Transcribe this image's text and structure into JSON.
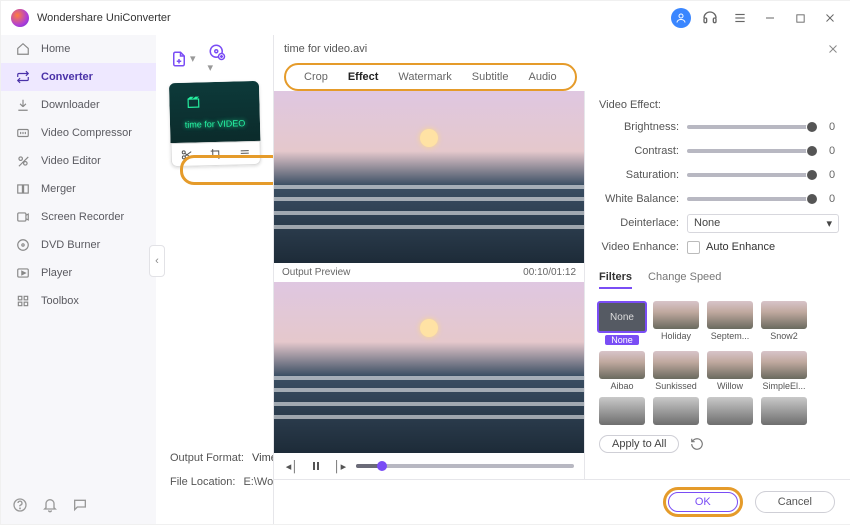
{
  "app": {
    "title": "Wondershare UniConverter"
  },
  "sidebar": {
    "items": [
      {
        "label": "Home"
      },
      {
        "label": "Converter"
      },
      {
        "label": "Downloader"
      },
      {
        "label": "Video Compressor"
      },
      {
        "label": "Video Editor"
      },
      {
        "label": "Merger"
      },
      {
        "label": "Screen Recorder"
      },
      {
        "label": "DVD Burner"
      },
      {
        "label": "Player"
      },
      {
        "label": "Toolbox"
      }
    ]
  },
  "stage": {
    "outputFormatLabel": "Output Format:",
    "outputFormatValue": "Vimeo",
    "fileLocLabel": "File Location:",
    "fileLocValue": "E:\\Won",
    "clipText": "time for\nVIDEO"
  },
  "editor": {
    "filename": "time for video.avi",
    "tabs": [
      "Crop",
      "Effect",
      "Watermark",
      "Subtitle",
      "Audio"
    ],
    "activeTab": "Effect",
    "previewLabel": "Output Preview",
    "time": "00:10/01:12",
    "ctrlTitle": "Video Effect:",
    "controls": {
      "brightness": {
        "label": "Brightness:",
        "value": 0
      },
      "contrast": {
        "label": "Contrast:",
        "value": 0
      },
      "saturation": {
        "label": "Saturation:",
        "value": 0
      },
      "whitebal": {
        "label": "White Balance:",
        "value": 0
      },
      "deinterlace": {
        "label": "Deinterlace:",
        "value": "None"
      },
      "enhanceLabel": "Video Enhance:",
      "autoEnhance": "Auto Enhance"
    },
    "subtabs": {
      "filters": "Filters",
      "speed": "Change Speed"
    },
    "filterNone": "None",
    "filters": [
      "None",
      "Holiday",
      "Septem...",
      "Snow2",
      "Aibao",
      "Sunkissed",
      "Willow",
      "SimpleEl..."
    ],
    "applyAll": "Apply to All",
    "ok": "OK",
    "cancel": "Cancel"
  }
}
